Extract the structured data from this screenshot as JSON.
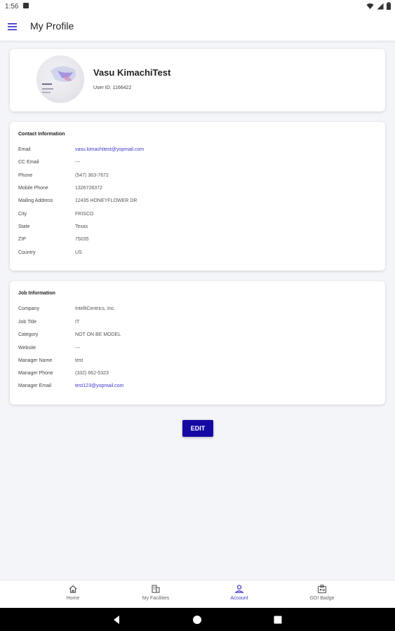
{
  "status_bar": {
    "time": "1:56",
    "icons": [
      "notification-icon",
      "wifi-icon",
      "signal-icon",
      "battery-icon"
    ]
  },
  "app_bar": {
    "title": "My Profile",
    "menu_icon": "hamburger-menu-icon"
  },
  "profile": {
    "name": "Vasu KimachiTest",
    "user_id": "User ID: 1166422"
  },
  "contact": {
    "title": "Contact Information",
    "rows": [
      {
        "label": "Email",
        "value": "vasu.kimachitest@yopmail.com"
      },
      {
        "label": "CC Email",
        "value": "---"
      },
      {
        "label": "Phone",
        "value": "(547) 363-7672"
      },
      {
        "label": "Mobile Phone",
        "value": "1326726372"
      },
      {
        "label": "Mailing Address",
        "value": "12435 HONEYFLOWER DR"
      },
      {
        "label": "City",
        "value": "FRISCO"
      },
      {
        "label": "State",
        "value": "Texas"
      },
      {
        "label": "ZIP",
        "value": "75035"
      },
      {
        "label": "Country",
        "value": "US"
      }
    ]
  },
  "job": {
    "title": "Job Information",
    "rows": [
      {
        "label": "Company",
        "value": "IntelliCentrics, Inc."
      },
      {
        "label": "Job Title",
        "value": "IT"
      },
      {
        "label": "Category",
        "value": "NOT ON BE MODEL"
      },
      {
        "label": "Website",
        "value": "---"
      },
      {
        "label": "Manager Name",
        "value": "test"
      },
      {
        "label": "Manager Phone",
        "value": "(332) 662-5323"
      },
      {
        "label": "Manager Email",
        "value": "test123@yopmail.com"
      }
    ]
  },
  "edit_label": "EDIT",
  "bottom_nav": [
    {
      "label": "Home",
      "icon": "home-icon",
      "active": false
    },
    {
      "label": "My Facilities",
      "icon": "building-icon",
      "active": false
    },
    {
      "label": "Account",
      "icon": "person-icon",
      "active": true
    },
    {
      "label": "GO! Badge",
      "icon": "badge-icon",
      "active": false
    }
  ],
  "colors": {
    "accent": "#1609a3",
    "link": "#3d3acb",
    "background": "#f4f5f9"
  }
}
